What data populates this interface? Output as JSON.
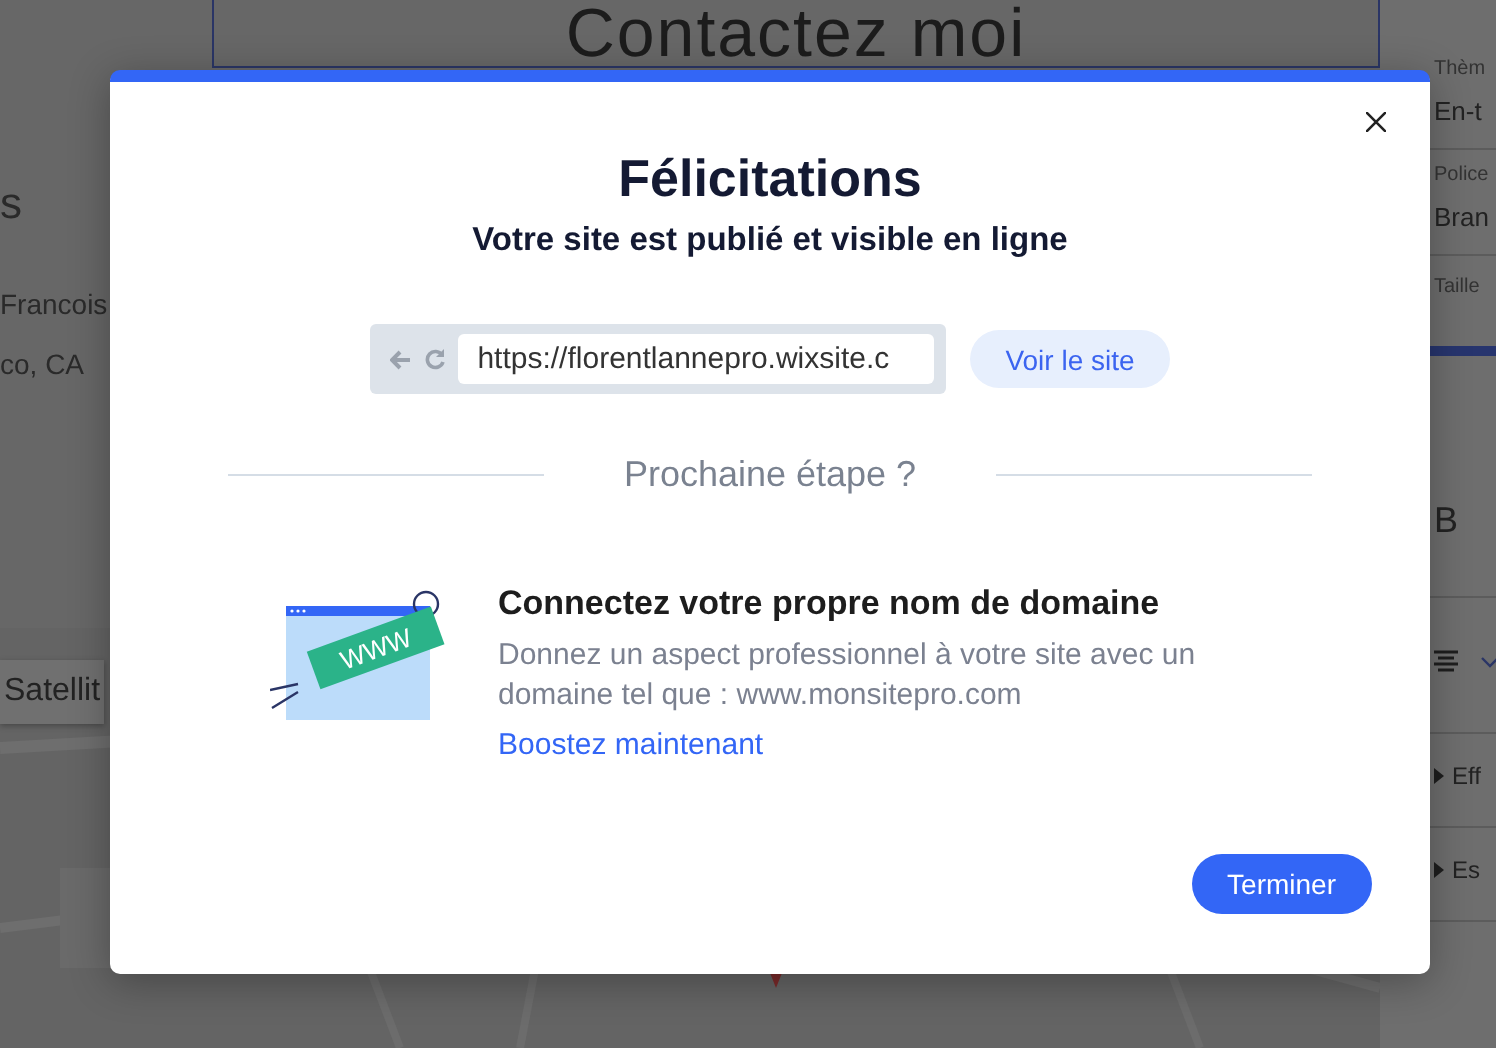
{
  "editor": {
    "heading": "Contactez moi",
    "left_texts": [
      "s",
      "Francois",
      "co, CA"
    ],
    "map": {
      "button": "Satellit"
    },
    "panel": {
      "sections": [
        {
          "kind": "field",
          "label": "Thèm",
          "value": "En-t"
        },
        {
          "kind": "field",
          "label": "Police",
          "value": "Bran"
        },
        {
          "kind": "bar",
          "label": "Taille"
        },
        {
          "kind": "letter",
          "value": "B"
        },
        {
          "kind": "align"
        },
        {
          "kind": "expander",
          "label": "Eff"
        },
        {
          "kind": "expander",
          "label": "Es"
        }
      ]
    }
  },
  "dialog": {
    "title": "Félicitations",
    "subtitle": "Votre site est publié et visible en ligne",
    "url": "https://florentlannepro.wixsite.c",
    "view_button": "Voir le site",
    "divider_label": "Prochaine étape ?",
    "next_step": {
      "title": "Connectez votre propre nom de domaine",
      "description": "Donnez un aspect professionnel à votre site avec un domaine tel que : www.monsitepro.com",
      "link": "Boostez maintenant"
    },
    "badge_text": "WWW",
    "finish_button": "Terminer"
  }
}
